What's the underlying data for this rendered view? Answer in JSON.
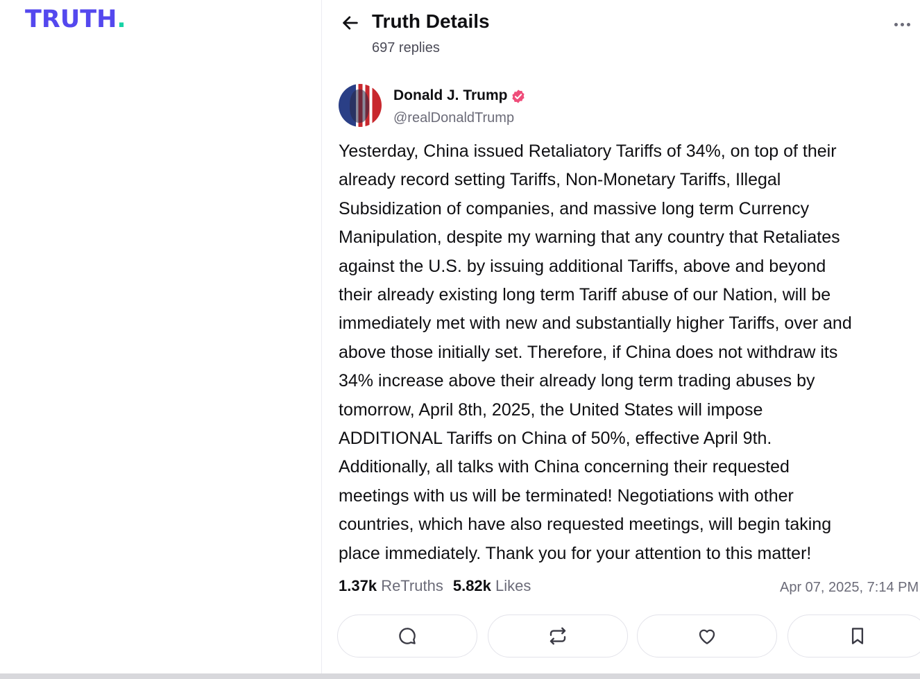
{
  "brand": {
    "name": "TRUTH",
    "dot": ".",
    "primary_color": "#5448ee",
    "accent_color": "#17d3a6"
  },
  "header": {
    "title": "Truth Details",
    "reply_count": "697 replies",
    "back_icon": "arrow-left-icon",
    "more_icon": "ellipsis-icon"
  },
  "post": {
    "author": {
      "display_name": "Donald J. Trump",
      "handle": "@realDonaldTrump",
      "verified": true,
      "verified_color": "#ef4d7a"
    },
    "lines": [
      "Yesterday, China issued Retaliatory Tariffs of 34%, on top of their",
      "already record setting Tariffs, Non-Monetary Tariffs, Illegal",
      "Subsidization of companies, and massive long term Currency",
      "Manipulation, despite my warning that any country that Retaliates",
      "against the U.S. by issuing additional Tariffs, above and beyond",
      "their already existing long term Tariff abuse of our Nation, will be",
      "immediately met with new and substantially higher Tariffs, over and",
      "above those initially set. Therefore, if China does not withdraw its",
      "34% increase above their already long term trading abuses by",
      "tomorrow, April 8th, 2025, the United States will impose",
      "ADDITIONAL Tariffs on China of 50%, effective April 9th.",
      "Additionally, all talks with China concerning their requested",
      "meetings with us will be terminated! Negotiations with other",
      "countries, which have also requested meetings, will begin taking",
      "place immediately. Thank you for your attention to this matter!"
    ],
    "retruths_count": "1.37k",
    "retruths_label": "ReTruths",
    "likes_count": "5.82k",
    "likes_label": "Likes",
    "timestamp": "Apr 07, 2025, 7:14 PM"
  },
  "actions": [
    {
      "name": "reply",
      "icon": "comment-icon"
    },
    {
      "name": "retruth",
      "icon": "repost-icon"
    },
    {
      "name": "like",
      "icon": "heart-icon"
    },
    {
      "name": "bookmark",
      "icon": "bookmark-icon"
    }
  ]
}
